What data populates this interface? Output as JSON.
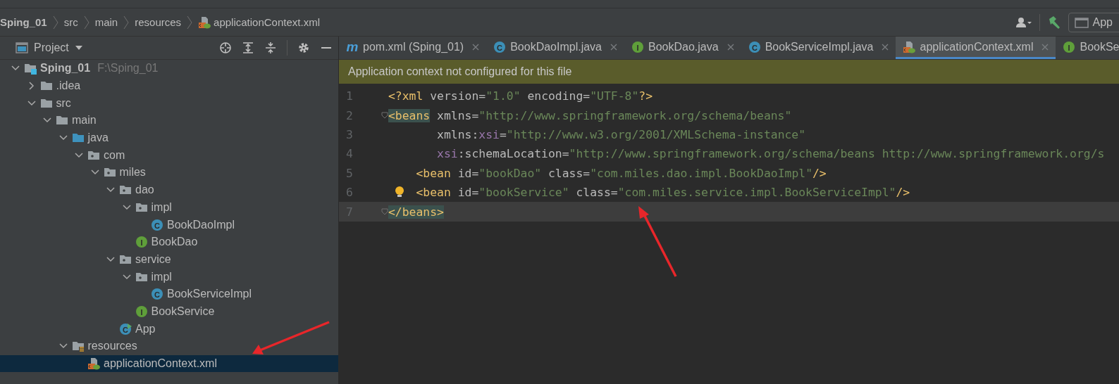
{
  "breadcrumbs": [
    {
      "label": "Sping_01",
      "kind": "project"
    },
    {
      "label": "src",
      "kind": "folder"
    },
    {
      "label": "main",
      "kind": "folder"
    },
    {
      "label": "resources",
      "kind": "folder"
    },
    {
      "label": "applicationContext.xml",
      "kind": "xml"
    }
  ],
  "toolbar": {
    "run_config": "App"
  },
  "project_panel": {
    "title": "Project",
    "tree": [
      {
        "label": "Sping_01",
        "path": "F:\\Sping_01",
        "kind": "project",
        "expanded": true,
        "selected": false,
        "children": [
          {
            "label": ".idea",
            "kind": "folder",
            "expanded": false,
            "selected": false
          },
          {
            "label": "src",
            "kind": "folder",
            "expanded": true,
            "selected": false,
            "children": [
              {
                "label": "main",
                "kind": "folder",
                "expanded": true,
                "selected": false,
                "children": [
                  {
                    "label": "java",
                    "kind": "source",
                    "expanded": true,
                    "selected": false,
                    "children": [
                      {
                        "label": "com",
                        "kind": "package",
                        "expanded": true,
                        "selected": false,
                        "children": [
                          {
                            "label": "miles",
                            "kind": "package",
                            "expanded": true,
                            "selected": false,
                            "children": [
                              {
                                "label": "dao",
                                "kind": "package",
                                "expanded": true,
                                "selected": false,
                                "children": [
                                  {
                                    "label": "impl",
                                    "kind": "package",
                                    "expanded": true,
                                    "selected": false,
                                    "children": [
                                      {
                                        "label": "BookDaoImpl",
                                        "kind": "class",
                                        "badge": "C",
                                        "selected": false
                                      }
                                    ]
                                  },
                                  {
                                    "label": "BookDao",
                                    "kind": "interface",
                                    "badge": "I",
                                    "selected": false
                                  }
                                ]
                              },
                              {
                                "label": "service",
                                "kind": "package",
                                "expanded": true,
                                "selected": false,
                                "children": [
                                  {
                                    "label": "impl",
                                    "kind": "package",
                                    "expanded": true,
                                    "selected": false,
                                    "children": [
                                      {
                                        "label": "BookServiceImpl",
                                        "kind": "class",
                                        "badge": "C",
                                        "selected": false
                                      }
                                    ]
                                  },
                                  {
                                    "label": "BookService",
                                    "kind": "interface",
                                    "badge": "I",
                                    "selected": false
                                  }
                                ]
                              },
                              {
                                "label": "App",
                                "kind": "main",
                                "badge": "C",
                                "selected": false
                              }
                            ]
                          }
                        ]
                      }
                    ]
                  },
                  {
                    "label": "resources",
                    "kind": "resources",
                    "expanded": true,
                    "selected": false,
                    "children": [
                      {
                        "label": "applicationContext.xml",
                        "kind": "xml",
                        "selected": true,
                        "annotated": true
                      }
                    ]
                  }
                ]
              }
            ]
          }
        ]
      }
    ]
  },
  "tabs": [
    {
      "label": "pom.xml (Sping_01)",
      "kind": "maven",
      "badge": "m",
      "selected": false
    },
    {
      "label": "BookDaoImpl.java",
      "kind": "class",
      "badge": "C",
      "selected": false
    },
    {
      "label": "BookDao.java",
      "kind": "interface",
      "badge": "I",
      "selected": false
    },
    {
      "label": "BookServiceImpl.java",
      "kind": "class",
      "badge": "C",
      "selected": false
    },
    {
      "label": "applicationContext.xml",
      "kind": "xml",
      "selected": true
    },
    {
      "label": "BookSe",
      "kind": "interface",
      "badge": "I",
      "selected": false
    }
  ],
  "banner": "Application context not configured for this file",
  "code": [
    {
      "number": "1",
      "current": false,
      "tokens": [
        {
          "kind": "tag",
          "text": "<?xml "
        },
        {
          "kind": "attr",
          "text": "version="
        },
        {
          "kind": "value",
          "text": "\"1.0\" "
        },
        {
          "kind": "attr",
          "text": "encoding="
        },
        {
          "kind": "value",
          "text": "\"UTF-8\""
        },
        {
          "kind": "tag",
          "text": "?>"
        }
      ]
    },
    {
      "number": "2",
      "fold": true,
      "current": false,
      "tokens": [
        {
          "kind": "tag",
          "text": "<beans",
          "highlight": true
        },
        {
          "kind": "attr",
          "text": " xmlns="
        },
        {
          "kind": "value",
          "text": "\"http://www.springframework.org/schema/beans\""
        }
      ]
    },
    {
      "number": "3",
      "current": false,
      "tokens": [
        {
          "kind": "attr",
          "text": "       xmlns:"
        },
        {
          "kind": "ns",
          "text": "xsi"
        },
        {
          "kind": "attr",
          "text": "="
        },
        {
          "kind": "value",
          "text": "\"http://www.w3.org/2001/XMLSchema-instance\""
        }
      ]
    },
    {
      "number": "4",
      "current": false,
      "tokens": [
        {
          "kind": "ns",
          "text": "       xsi"
        },
        {
          "kind": "attr",
          "text": ":schemaLocation="
        },
        {
          "kind": "value",
          "text": "\"http://www.springframework.org/schema/beans http://www.springframework.org/s"
        }
      ]
    },
    {
      "number": "5",
      "current": false,
      "tokens": [
        {
          "kind": "tag",
          "text": "    <bean "
        },
        {
          "kind": "attr",
          "text": "id="
        },
        {
          "kind": "value",
          "text": "\"bookDao\" "
        },
        {
          "kind": "attr",
          "text": "class="
        },
        {
          "kind": "value",
          "text": "\"com.miles.dao.impl.BookDaoImpl\""
        },
        {
          "kind": "tag",
          "text": "/>"
        }
      ]
    },
    {
      "number": "6",
      "bulb": true,
      "current": false,
      "tokens": [
        {
          "kind": "tag",
          "text": "    <bean "
        },
        {
          "kind": "attr",
          "text": "id="
        },
        {
          "kind": "value",
          "text": "\"bookService\" "
        },
        {
          "kind": "attr",
          "text": "class="
        },
        {
          "kind": "value",
          "text": "\"com.miles.service.impl.BookServiceImpl\""
        },
        {
          "kind": "tag",
          "text": "/>"
        }
      ]
    },
    {
      "number": "7",
      "fold": true,
      "current": true,
      "annotated": true,
      "tokens": [
        {
          "kind": "tag",
          "text": "</beans>",
          "highlight": true
        }
      ]
    }
  ]
}
